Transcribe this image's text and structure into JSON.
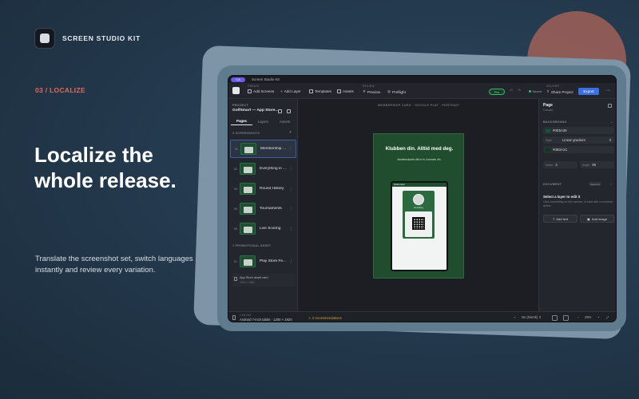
{
  "brand": {
    "name": "SCREEN STUDIO KIT"
  },
  "step": "03 / LOCALIZE",
  "hero": {
    "line1": "Localize the",
    "line2": "whole release."
  },
  "subtitle": "Translate the screenshot set, switch languages instantly and review every variation.",
  "app": {
    "titlebar": {
      "badge": "CA",
      "title": "Screen Studio Kit"
    },
    "toolbar": {
      "create_group": "CREATE",
      "add_screens": "Add Screens",
      "add_layer": "Add Layer",
      "templates": "Templates",
      "assets": "Assets",
      "review_group": "REVIEW",
      "preview": "Preview",
      "preflight": "Preflight",
      "pro": "Pro",
      "saved": "Saved",
      "deliver_group": "DELIVER",
      "share": "Share Project",
      "export": "Export",
      "more": "⋯"
    },
    "left": {
      "project_label": "PROJECT",
      "project_name": "GolfSmart — App Store…",
      "tabs": [
        "Pages",
        "Layers",
        "Assets"
      ],
      "screens_header": "5 SCREENSHOTS",
      "screens": [
        {
          "num": "01",
          "label": "Membership …"
        },
        {
          "num": "02",
          "label": "Everything in …"
        },
        {
          "num": "03",
          "label": "Round History"
        },
        {
          "num": "04",
          "label": "Tournaments"
        },
        {
          "num": "05",
          "label": "Live Scoring"
        }
      ],
      "promo_header": "1 PROMOTIONAL ASSET",
      "promo": {
        "num": "01",
        "label": "Play Store Fe…"
      },
      "asset": {
        "title": "App Store asset card",
        "dims": "1024 × 1080"
      }
    },
    "canvas": {
      "caption": "MEMBERSHIP CARD · GOOGLE PLAY · PORTRAIT",
      "headline": "Klubben din. Alltid med deg.",
      "subline": "Medlemskortet ditt er fo i lommen din.",
      "device_bar": "Medlemskort",
      "member_name": "Anna Berg"
    },
    "right": {
      "title": "Page",
      "subtitle": "Canvas",
      "background_section": "BACKGROUND",
      "color1": "#0E5A36",
      "style_label": "Style",
      "style_value": "Linear gradient",
      "color2": "#0B3A1C",
      "angle_label": "Noise",
      "angle_value": "3",
      "grad_label": "Angle",
      "grad_value": "95",
      "document_section": "DOCUMENT",
      "document_badge": "Selected",
      "empty_title": "Select a layer to edit it",
      "empty_text": "Click something on the canvas, or start with a common action.",
      "add_text": "Add text",
      "add_image": "Add image"
    },
    "status": {
      "group": "CANVAS",
      "device": "Android 7-inch tablet · 1200 × 1920",
      "recommendations": "2 recommendations",
      "locale": "No (Norsk)",
      "zoom": "28%"
    }
  },
  "colors": {
    "accent": "#3B6FE0",
    "highlight": "#E0695E",
    "card_green": "#1F4D2E",
    "pro_green": "#5FE08C",
    "warning": "#D7A13C"
  },
  "icons": [
    "app-logo-icon",
    "add-screens-icon",
    "add-layer-icon",
    "templates-icon",
    "assets-icon",
    "preview-icon",
    "preflight-icon",
    "undo-icon",
    "redo-icon",
    "share-icon",
    "grid-icon",
    "collapse-icon"
  ]
}
